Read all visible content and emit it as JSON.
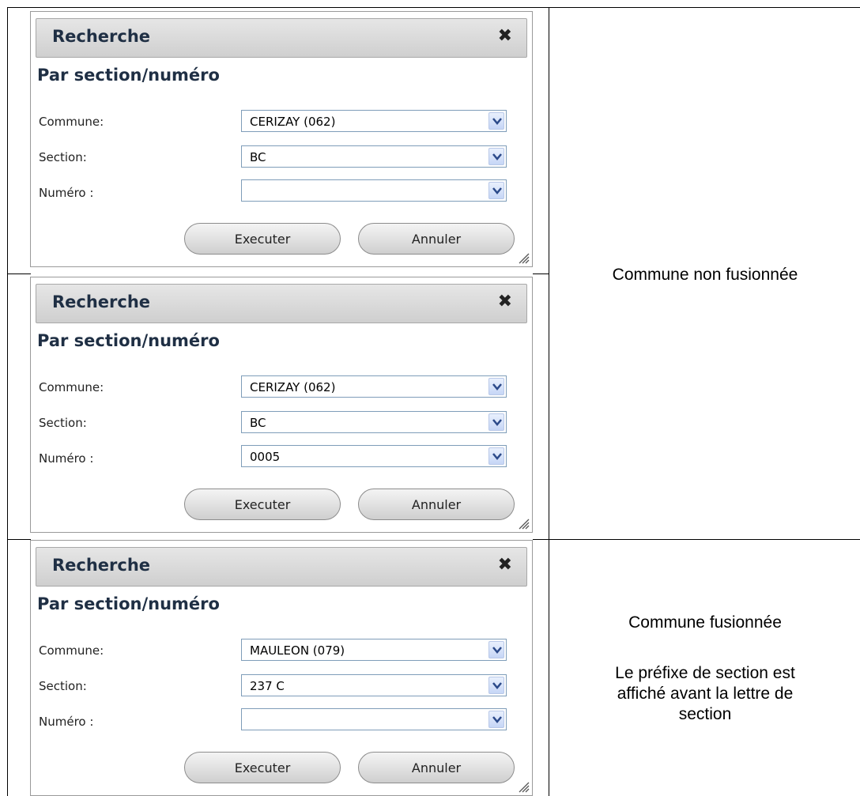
{
  "panels": [
    {
      "title": "Recherche",
      "close_icon": "close-icon",
      "subtitle": "Par section/numéro",
      "commune_label": "Commune:",
      "commune_value": "CERIZAY (062)",
      "section_label": "Section:",
      "section_value": "BC",
      "numero_label": "Numéro :",
      "numero_value": "",
      "execute_label": "Executer",
      "cancel_label": "Annuler"
    },
    {
      "title": "Recherche",
      "close_icon": "close-icon",
      "subtitle": "Par section/numéro",
      "commune_label": "Commune:",
      "commune_value": "CERIZAY (062)",
      "section_label": "Section:",
      "section_value": "BC",
      "numero_label": "Numéro :",
      "numero_value": "0005",
      "execute_label": "Executer",
      "cancel_label": "Annuler"
    },
    {
      "title": "Recherche",
      "close_icon": "close-icon",
      "subtitle": "Par section/numéro",
      "commune_label": "Commune:",
      "commune_value": "MAULEON (079)",
      "section_label": "Section:",
      "section_value": "237 C",
      "numero_label": "Numéro :",
      "numero_value": "",
      "execute_label": "Executer",
      "cancel_label": "Annuler"
    }
  ],
  "notes": {
    "non_fusion": "Commune non fusionnée",
    "fusion_title": "Commune fusionnée",
    "fusion_line1": "Le préfixe de section est",
    "fusion_line2": "affiché avant la lettre de",
    "fusion_line3": "section"
  },
  "colors": {
    "title_text": "#1f2f44",
    "select_border": "#7f9db9",
    "panel_border": "#9a9a9a"
  }
}
